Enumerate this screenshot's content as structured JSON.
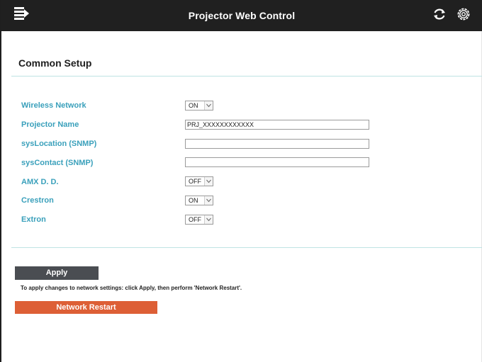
{
  "app": {
    "title": "Projector Web Control",
    "icons": [
      "menu-icon",
      "refresh-icon",
      "settings-icon"
    ]
  },
  "section": {
    "title": "Common Setup"
  },
  "fields": [
    {
      "label": "Wireless Network",
      "type": "select",
      "value": "ON"
    },
    {
      "label": "Projector Name",
      "type": "text",
      "value": "PRJ_XXXXXXXXXXXX"
    },
    {
      "label": "sysLocation (SNMP)",
      "type": "text",
      "value": ""
    },
    {
      "label": "sysContact (SNMP)",
      "type": "text",
      "value": ""
    },
    {
      "label": "AMX D. D.",
      "type": "select",
      "value": "OFF"
    },
    {
      "label": "Crestron",
      "type": "select",
      "value": "ON"
    },
    {
      "label": "Extron",
      "type": "select",
      "value": "OFF"
    }
  ],
  "actions": {
    "apply_label": "Apply",
    "note": "To apply changes to network settings: click Apply, then perform 'Network Restart'.",
    "restart_label": "Network Restart"
  },
  "colors": {
    "header_bg": "#202020",
    "label": "#3aa0bb",
    "apply_bg": "#4a4d52",
    "restart_bg": "#dd5f36",
    "divider": "#bfe3e3"
  }
}
